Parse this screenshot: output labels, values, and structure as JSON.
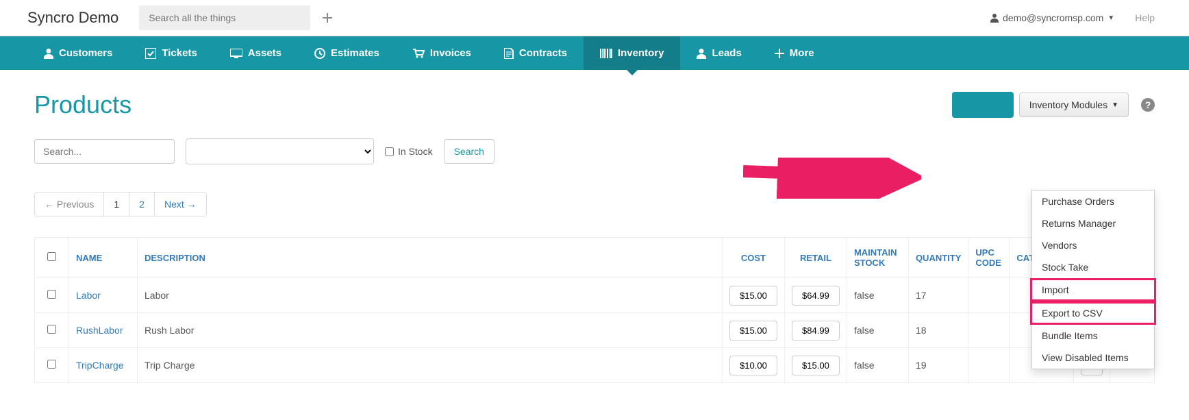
{
  "topbar": {
    "brand": "Syncro Demo",
    "search_placeholder": "Search all the things",
    "user_email": "demo@syncromsp.com",
    "help": "Help"
  },
  "nav": {
    "items": [
      {
        "label": "Customers",
        "icon": "user"
      },
      {
        "label": "Tickets",
        "icon": "check"
      },
      {
        "label": "Assets",
        "icon": "monitor"
      },
      {
        "label": "Estimates",
        "icon": "clock"
      },
      {
        "label": "Invoices",
        "icon": "cart"
      },
      {
        "label": "Contracts",
        "icon": "file"
      },
      {
        "label": "Inventory",
        "icon": "barcode",
        "active": true
      },
      {
        "label": "Leads",
        "icon": "user"
      },
      {
        "label": "More",
        "icon": "plus"
      }
    ]
  },
  "page": {
    "title": "Products",
    "modules_btn": "Inventory Modules"
  },
  "dropdown": {
    "items": [
      {
        "label": "Purchase Orders"
      },
      {
        "label": "Returns Manager"
      },
      {
        "label": "Vendors"
      },
      {
        "label": "Stock Take"
      },
      {
        "label": "Import",
        "highlighted": true
      },
      {
        "label": "Export to CSV",
        "highlighted": true
      },
      {
        "label": "Bundle Items"
      },
      {
        "label": "View Disabled Items"
      }
    ]
  },
  "filters": {
    "search_placeholder": "Search...",
    "instock_label": "In Stock",
    "search_btn": "Search"
  },
  "pagination": {
    "prev": "← Previous",
    "pages": [
      "1",
      "2"
    ],
    "next": "Next →",
    "current": "1"
  },
  "table": {
    "headers": [
      "NAME",
      "DESCRIPTION",
      "COST",
      "RETAIL",
      "MAINTAIN STOCK",
      "QUANTITY",
      "UPC CODE",
      "CATEGORY",
      "",
      ""
    ],
    "rows": [
      {
        "name": "Labor",
        "description": "Labor",
        "cost": "$15.00",
        "retail": "$64.99",
        "maintain": "false",
        "quantity": "17",
        "upc": "",
        "category": "",
        "action": "disable"
      },
      {
        "name": "RushLabor",
        "description": "Rush Labor",
        "cost": "$15.00",
        "retail": "$84.99",
        "maintain": "false",
        "quantity": "18",
        "upc": "",
        "category": "",
        "action": "disable"
      },
      {
        "name": "TripCharge",
        "description": "Trip Charge",
        "cost": "$10.00",
        "retail": "$15.00",
        "maintain": "false",
        "quantity": "19",
        "upc": "",
        "category": "",
        "action": "disable"
      }
    ]
  }
}
